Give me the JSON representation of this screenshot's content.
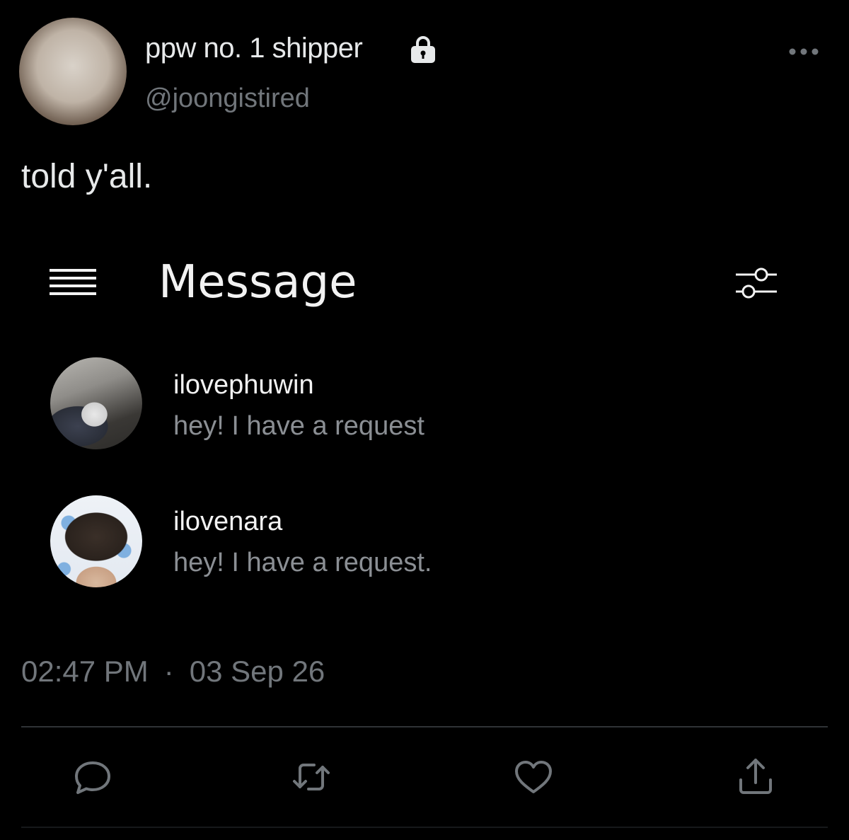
{
  "tweet": {
    "display_name": "ppw no. 1 shipper",
    "handle": "@joongistired",
    "text": "told y'all.",
    "timestamp_time": "02:47 PM",
    "timestamp_separator": "·",
    "timestamp_date": "03 Sep 26",
    "avatar_icon": "user-avatar",
    "protected_icon": "lock-icon",
    "more_icon": "more-horizontal-icon"
  },
  "embedded_screenshot": {
    "title": "Message",
    "menu_icon": "hamburger-menu-icon",
    "filter_icon": "sliders-icon",
    "conversations": [
      {
        "name": "ilovephuwin",
        "preview": "hey! I have a request"
      },
      {
        "name": "ilovenara",
        "preview": "hey! I have a request."
      }
    ]
  },
  "actions": {
    "reply_icon": "reply-icon",
    "retweet_icon": "retweet-icon",
    "like_icon": "heart-icon",
    "share_icon": "share-icon"
  },
  "colors": {
    "background": "#000000",
    "primary_text": "#e7e9ea",
    "secondary_text": "#71767b",
    "divider": "#2f3336"
  }
}
